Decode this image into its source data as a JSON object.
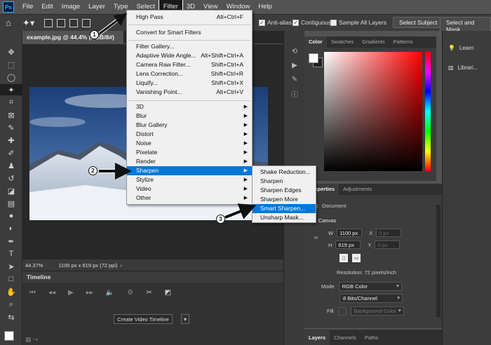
{
  "menubar": {
    "logo": "Ps",
    "items": [
      "File",
      "Edit",
      "Image",
      "Layer",
      "Type",
      "Select",
      "Filter",
      "3D",
      "View",
      "Window",
      "Help"
    ],
    "active": "Filter"
  },
  "options": {
    "anti_alias": "Anti-alias",
    "contiguous": "Contiguous",
    "sample_all": "Sample All Layers",
    "select_subject": "Select Subject",
    "select_mask": "Select and Mask..."
  },
  "document": {
    "tab_title": "example.jpg @ 44.4% (RGB/8#)",
    "zoom": "44.37%",
    "size_info": "1100 px x 619 px (72 ppi)"
  },
  "timeline": {
    "title": "Timeline",
    "create_button": "Create Video Timeline"
  },
  "filter_menu": {
    "last_filter": "High Pass",
    "last_filter_shortcut": "Alt+Ctrl+F",
    "convert": "Convert for Smart Filters",
    "gallery": "Filter Gallery...",
    "adaptive": "Adaptive Wide Angle...",
    "adaptive_shortcut": "Alt+Shift+Ctrl+A",
    "camera_raw": "Camera Raw Filter...",
    "camera_raw_shortcut": "Shift+Ctrl+A",
    "lens": "Lens Correction...",
    "lens_shortcut": "Shift+Ctrl+R",
    "liquify": "Liquify...",
    "liquify_shortcut": "Shift+Ctrl+X",
    "vanishing": "Vanishing Point...",
    "vanishing_shortcut": "Alt+Ctrl+V",
    "submenus": [
      "3D",
      "Blur",
      "Blur Gallery",
      "Distort",
      "Noise",
      "Pixelate",
      "Render",
      "Sharpen",
      "Stylize",
      "Video",
      "Other"
    ],
    "highlighted": "Sharpen"
  },
  "sharpen_menu": {
    "items": [
      "Shake Reduction...",
      "Sharpen",
      "Sharpen Edges",
      "Sharpen More",
      "Smart Sharpen...",
      "Unsharp Mask..."
    ],
    "highlighted": "Smart Sharpen..."
  },
  "color_panel": {
    "tabs": [
      "Color",
      "Swatches",
      "Gradients",
      "Patterns"
    ]
  },
  "properties_panel": {
    "tabs": [
      "Properties",
      "Adjustments"
    ],
    "document_label": "Document",
    "canvas_label": "Canvas",
    "w_label": "W",
    "w_value": "1100 px",
    "x_label": "X",
    "x_value": "0 px",
    "h_label": "H",
    "h_value": "619 px",
    "y_label": "Y",
    "y_value": "0 px",
    "resolution": "Resolution: 72 pixels/inch",
    "mode_label": "Mode",
    "mode_value": "RGB Color",
    "depth_value": "8 Bits/Channel",
    "fill_label": "Fill",
    "fill_value": "Background Color"
  },
  "layers_tabs": [
    "Layers",
    "Channels",
    "Paths"
  ],
  "learn_panel": {
    "learn": "Learn",
    "libraries": "Librari..."
  },
  "callouts": [
    "1",
    "2",
    "3"
  ]
}
